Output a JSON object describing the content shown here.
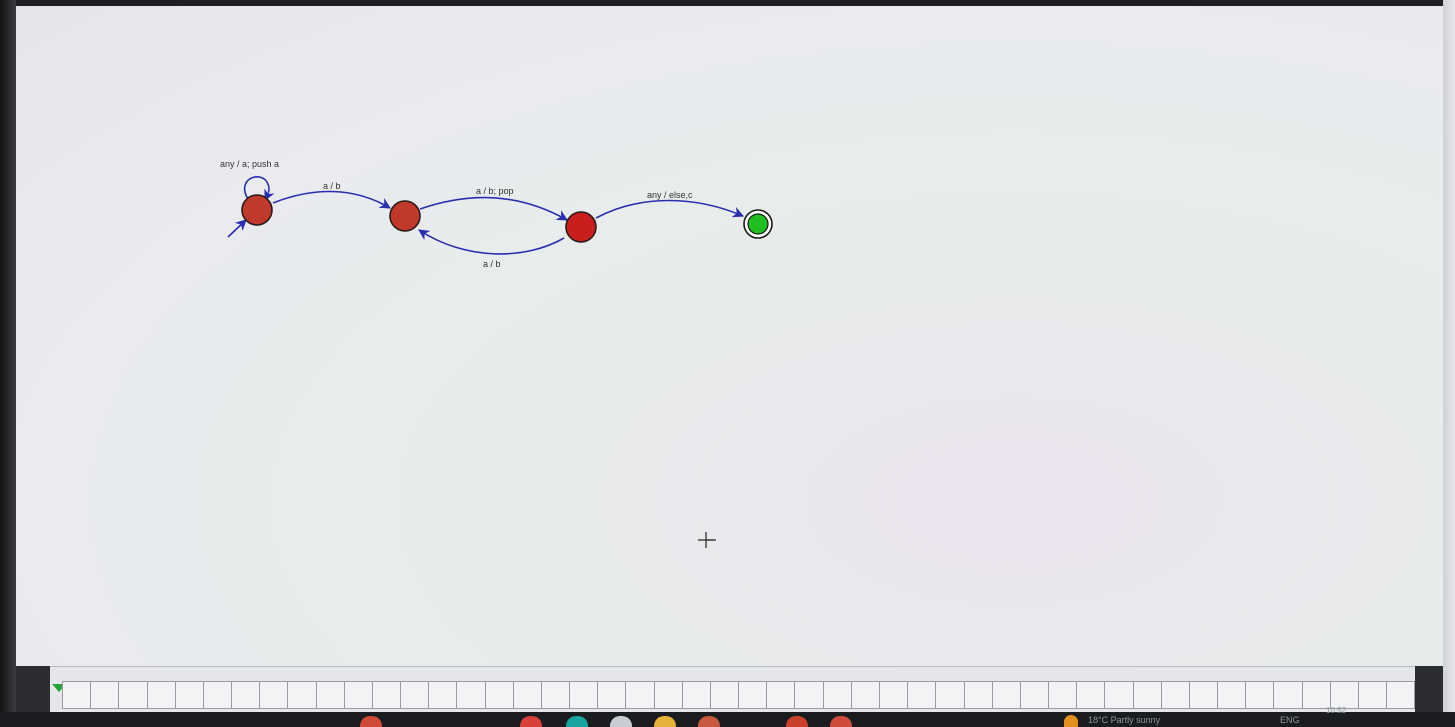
{
  "automaton": {
    "states": [
      {
        "id": "q0",
        "kind": "start"
      },
      {
        "id": "q1",
        "kind": "normal"
      },
      {
        "id": "q2",
        "kind": "normal"
      },
      {
        "id": "q3",
        "kind": "accept"
      }
    ],
    "transitions": [
      {
        "from": "q0",
        "to": "q0",
        "label": "any / a; push a"
      },
      {
        "from": "q0",
        "to": "q1",
        "label": "a / b"
      },
      {
        "from": "q1",
        "to": "q2",
        "label": "a / b; pop"
      },
      {
        "from": "q2",
        "to": "q1",
        "label": "a / b"
      },
      {
        "from": "q2",
        "to": "q3",
        "label": "any / else,c"
      }
    ],
    "state_color": "#c0392b",
    "accept_color": "#1fbf1f",
    "edge_color": "#2a2fb0"
  },
  "taskbar": {
    "weather": "18°C  Partly sunny",
    "language": "ENG",
    "clock": "10:52"
  }
}
